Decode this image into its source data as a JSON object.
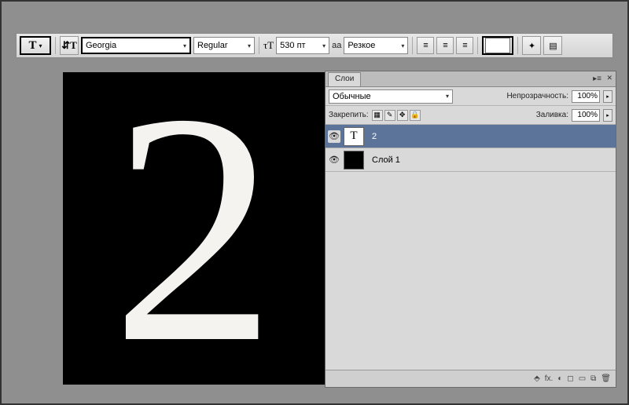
{
  "toolbar": {
    "font_family": "Georgia",
    "font_style": "Regular",
    "font_size": "530 пт",
    "aa_prefix": "aa",
    "aa_mode": "Резкое",
    "color": "#ffffff"
  },
  "canvas": {
    "glyph": "2"
  },
  "panel": {
    "title": "Слои",
    "blend_mode": "Обычные",
    "opacity_label": "Непрозрачность:",
    "opacity_value": "100%",
    "lock_label": "Закрепить:",
    "fill_label": "Заливка:",
    "fill_value": "100%",
    "layers": [
      {
        "name": "2",
        "type": "text",
        "visible": true,
        "active": true
      },
      {
        "name": "Слой 1",
        "type": "raster",
        "visible": true,
        "active": false
      }
    ],
    "footer_icons": [
      "⬘",
      "fx.",
      "◐",
      "◻",
      "▭",
      "⧉",
      "🗑"
    ]
  }
}
